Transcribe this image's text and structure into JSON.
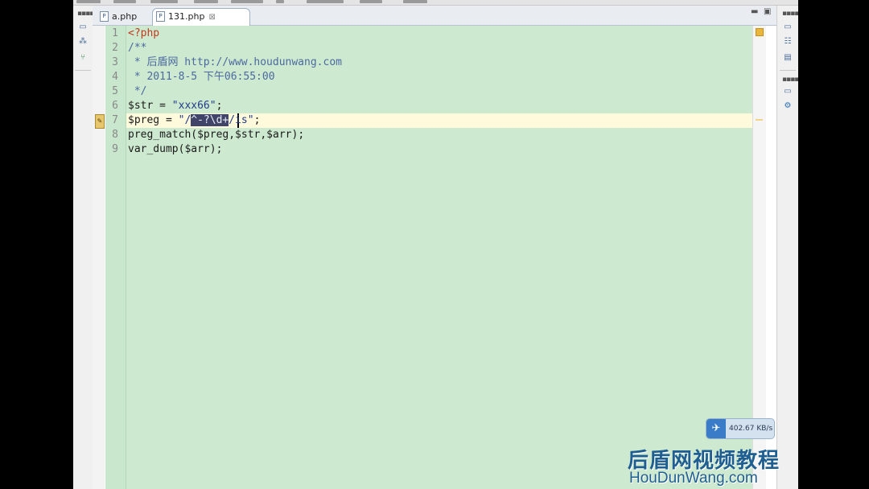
{
  "tabs": [
    {
      "label": "a.php",
      "active": false
    },
    {
      "label": "131.php",
      "active": true,
      "close_glyph": "⊠"
    }
  ],
  "code_lines": [
    {
      "num": "1",
      "parts": [
        {
          "t": "<?php",
          "c": "tag"
        }
      ]
    },
    {
      "num": "2",
      "parts": [
        {
          "t": "/**",
          "c": "cmt"
        }
      ]
    },
    {
      "num": "3",
      "parts": [
        {
          "t": " * 后盾网 http://www.houdunwang.com",
          "c": "cmt"
        }
      ]
    },
    {
      "num": "4",
      "parts": [
        {
          "t": " * 2011-8-5 下午06:55:00",
          "c": "cmt"
        }
      ]
    },
    {
      "num": "5",
      "parts": [
        {
          "t": " */",
          "c": "cmt"
        }
      ]
    },
    {
      "num": "6",
      "parts": [
        {
          "t": "$str",
          "c": "var"
        },
        {
          "t": " = ",
          "c": "var"
        },
        {
          "t": "\"xxx66\"",
          "c": "str"
        },
        {
          "t": ";",
          "c": "var"
        }
      ]
    },
    {
      "num": "7",
      "parts": [
        {
          "t": "$preg",
          "c": "var"
        },
        {
          "t": " = ",
          "c": "var"
        },
        {
          "t": "\"/",
          "c": "str"
        },
        {
          "t": "^-?\\d+",
          "c": "sel"
        },
        {
          "t": "/is\"",
          "c": "str"
        },
        {
          "t": ";",
          "c": "var"
        }
      ]
    },
    {
      "num": "8",
      "parts": [
        {
          "t": "preg_match($preg,$str,$arr);",
          "c": "var"
        }
      ]
    },
    {
      "num": "9",
      "parts": [
        {
          "t": "var_dump($arr);",
          "c": "var"
        }
      ]
    }
  ],
  "current_line": "7",
  "network_speed": "402.67 KB/s",
  "watermark": {
    "cn": "后盾网视频教程",
    "en": "HouDunWang.com"
  },
  "colors": {
    "editor_background": "#cde9d0",
    "current_line": "#fffadc",
    "selection": "#3f4468",
    "php_tag": "#c03a1e",
    "comment": "#4c69a0",
    "string": "#223c8c"
  },
  "icons": {
    "file_icon": "P",
    "close_icon": "⊠",
    "plane_icon": "✈"
  }
}
